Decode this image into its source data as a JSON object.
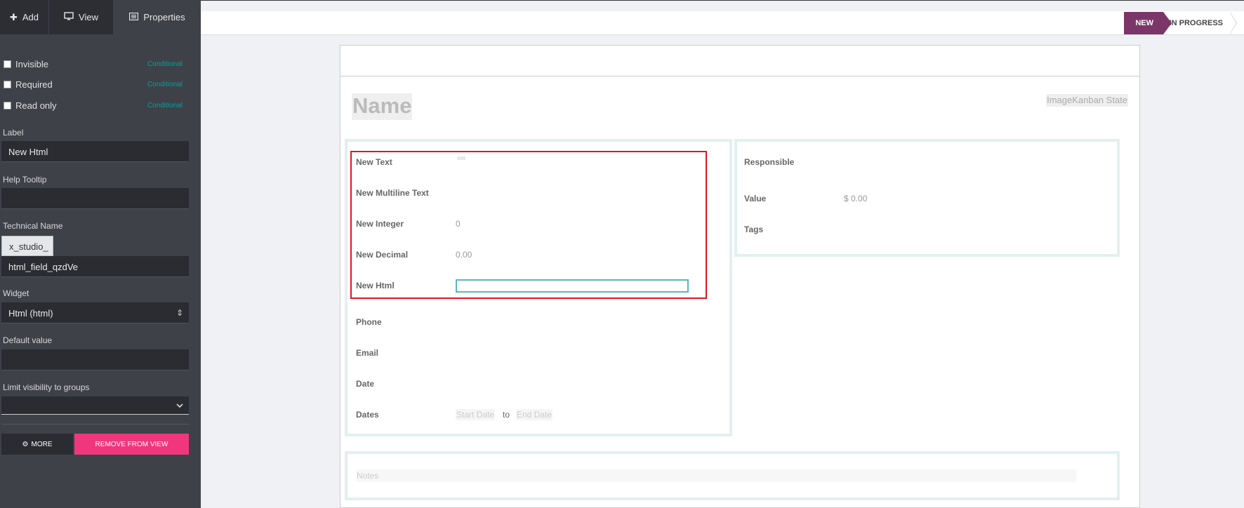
{
  "sidebar": {
    "tabs": [
      {
        "label": "Add",
        "icon": "plus-icon"
      },
      {
        "label": "View",
        "icon": "monitor-icon"
      },
      {
        "label": "Properties",
        "icon": "list-icon"
      }
    ],
    "checkboxes": [
      {
        "label": "Invisible",
        "conditional": "Conditional",
        "checked": false
      },
      {
        "label": "Required",
        "conditional": "Conditional",
        "checked": false
      },
      {
        "label": "Read only",
        "conditional": "Conditional",
        "checked": false
      }
    ],
    "label_title": "Label",
    "label_value": "New Html",
    "help_title": "Help Tooltip",
    "help_value": "",
    "technical_title": "Technical Name",
    "technical_prefix": "x_studio_",
    "technical_value": "html_field_qzdVe",
    "widget_title": "Widget",
    "widget_value": "Html (html)",
    "default_title": "Default value",
    "default_value": "",
    "groups_title": "Limit visibility to groups",
    "groups_value": "",
    "more_label": "MORE",
    "remove_label": "REMOVE FROM VIEW"
  },
  "statusbar": {
    "stages": [
      "NEW",
      "IN PROGRESS"
    ],
    "active_stage": "NEW"
  },
  "form": {
    "name_placeholder": "Name",
    "top_right_text": "ImageKanban State",
    "left_fields": [
      {
        "label": "New Text",
        "value": ""
      },
      {
        "label": "New Multiline Text",
        "value": ""
      },
      {
        "label": "New Integer",
        "value": "0"
      },
      {
        "label": "New Decimal",
        "value": "0.00"
      },
      {
        "label": "New Html",
        "value": ""
      },
      {
        "label": "Phone",
        "value": ""
      },
      {
        "label": "Email",
        "value": ""
      },
      {
        "label": "Date",
        "value": ""
      },
      {
        "label": "Dates",
        "value": ""
      }
    ],
    "dates_start_placeholder": "Start Date",
    "dates_to": "to",
    "dates_end_placeholder": "End Date",
    "right_fields": [
      {
        "label": "Responsible",
        "value": ""
      },
      {
        "label": "Value",
        "value": "$ 0.00"
      },
      {
        "label": "Tags",
        "value": ""
      }
    ],
    "notes_placeholder": "Notes"
  },
  "colors": {
    "sidebar_bg": "#3f4148",
    "accent_teal": "#00a09d",
    "stage_active": "#7c3569",
    "remove_button": "#f0377d",
    "selection_border": "#e0161b"
  }
}
